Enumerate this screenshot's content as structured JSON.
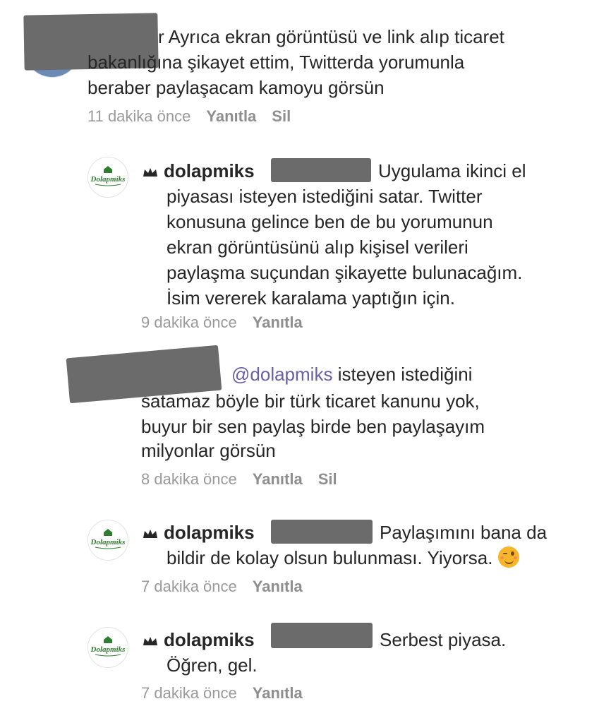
{
  "comments": [
    {
      "id": "c1",
      "username_suffix": "r",
      "text_lines": [
        "Ayrıca ekran görüntüsü ve link alıp ticaret",
        "bakanlığına şikayet ettim, Twitterda yorumunla",
        "beraber paylaşacam kamoyu görsün"
      ],
      "time": "11 dakika önce",
      "reply_label": "Yanıtla",
      "delete_label": "Sil"
    },
    {
      "id": "c2",
      "username": "dolapmiks",
      "text_lines": [
        "Uygulama ikinci el",
        "piyasası isteyen istediğini satar. Twitter",
        "konusuna gelince ben de bu yorumunun",
        "ekran görüntüsünü alıp kişisel verileri",
        "paylaşma suçundan şikayette bulunacağım.",
        "İsim vererek karalama yaptığın için."
      ],
      "time": "9 dakika önce",
      "reply_label": "Yanıtla"
    },
    {
      "id": "c3",
      "mention": "@dolapmiks",
      "text_lines": [
        "isteyen istediğini",
        "satamaz böyle bir türk ticaret kanunu yok,",
        "buyur bir sen paylaş birde ben paylaşayım",
        "milyonlar görsün"
      ],
      "time": "8 dakika önce",
      "reply_label": "Yanıtla",
      "delete_label": "Sil"
    },
    {
      "id": "c4",
      "username": "dolapmiks",
      "text_lines": [
        "Paylaşımını bana da",
        "bildir de kolay olsun bulunması. Yiyorsa."
      ],
      "time": "7 dakika önce",
      "reply_label": "Yanıtla"
    },
    {
      "id": "c5",
      "username": "dolapmiks",
      "text_lines": [
        "Serbest piyasa.",
        "Öğren, gel."
      ],
      "time": "7 dakika önce",
      "reply_label": "Yanıtla"
    }
  ],
  "avatar_logo_text": "Dolapmiks",
  "emoji": "winking-face",
  "colors": {
    "text": "#262626",
    "meta": "#9a9a9a",
    "mention": "#6a5fa8",
    "redaction": "#6b6b6b",
    "logo_green": "#2f7d2f"
  }
}
